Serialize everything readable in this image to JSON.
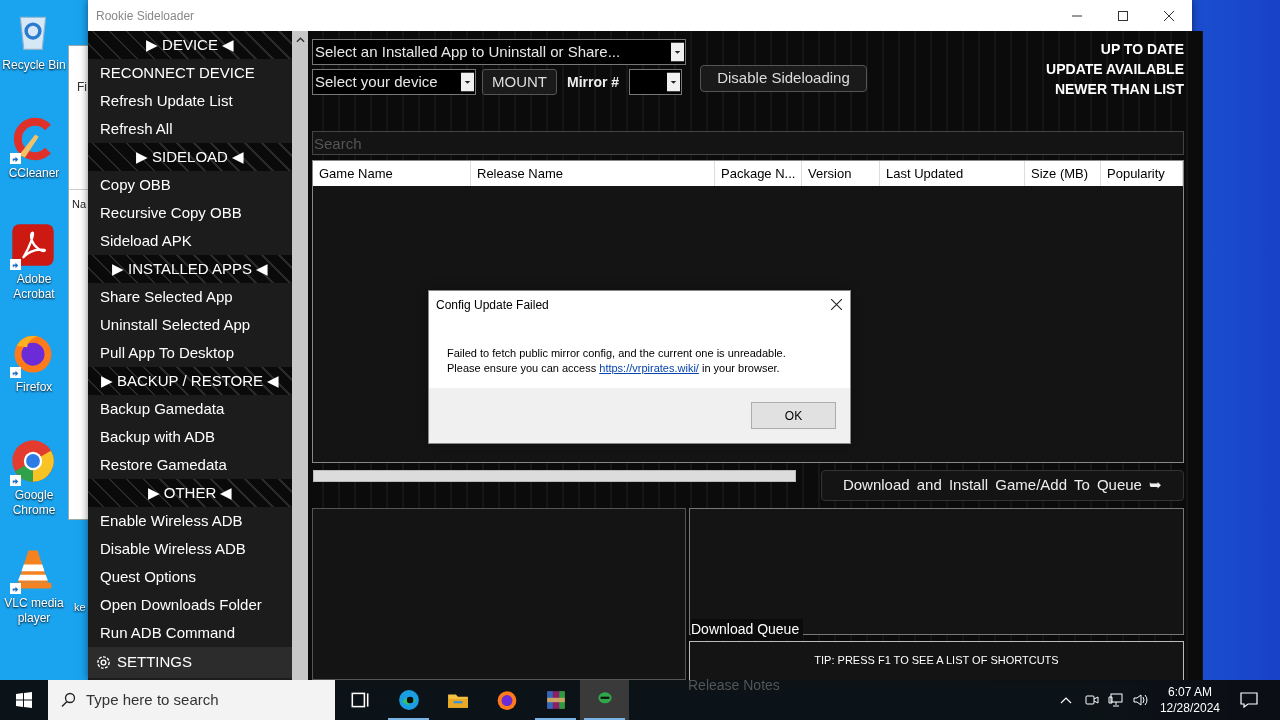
{
  "desktop": {
    "icons": [
      {
        "kind": "recycle",
        "label": "Recycle Bin",
        "shortcut": false
      },
      {
        "kind": "ccleaner",
        "label": "CCleaner",
        "shortcut": true
      },
      {
        "kind": "acrobat",
        "label": "Adobe Acrobat",
        "shortcut": true
      },
      {
        "kind": "firefox",
        "label": "Firefox",
        "shortcut": true
      },
      {
        "kind": "chrome",
        "label": "Google Chrome",
        "shortcut": true
      },
      {
        "kind": "vlc",
        "label": "VLC media player",
        "shortcut": true
      }
    ],
    "partial_label": "ke"
  },
  "background_window": {
    "menu_text": "Fi",
    "column_text": "Na"
  },
  "window": {
    "title": "Rookie Sideloader",
    "sidebar": {
      "sections": [
        {
          "title": "▶ DEVICE ◀",
          "items": [
            "RECONNECT DEVICE",
            "Refresh Update List",
            "Refresh All"
          ]
        },
        {
          "title": "▶ SIDELOAD ◀",
          "items": [
            "Copy OBB",
            "Recursive Copy OBB",
            "Sideload APK"
          ]
        },
        {
          "title": "▶ INSTALLED APPS ◀",
          "items": [
            "Share Selected App",
            "Uninstall Selected App",
            "Pull App To Desktop"
          ]
        },
        {
          "title": "▶ BACKUP / RESTORE ◀",
          "items": [
            "Backup Gamedata",
            "Backup with ADB",
            "Restore Gamedata"
          ]
        },
        {
          "title": "▶ OTHER ◀",
          "items": [
            "Enable Wireless ADB",
            "Disable Wireless ADB",
            "Quest Options",
            "Open Downloads Folder",
            "Run ADB Command"
          ]
        }
      ],
      "settings": "SETTINGS"
    },
    "app_select": "Select an Installed App to Uninstall or Share...",
    "device_select": "Select your device",
    "mount_button": "MOUNT",
    "mirror_label": "Mirror #",
    "disable_button": "Disable Sideloading",
    "status_labels": [
      "UP TO DATE",
      "UPDATE AVAILABLE",
      "NEWER THAN LIST"
    ],
    "search": {
      "placeholder": "Search"
    },
    "table": {
      "columns": [
        "Game Name",
        "Release Name",
        "Package N...",
        "Version",
        "Last Updated",
        "Size (MB)",
        "Popularity"
      ]
    },
    "progress": {
      "level": 0
    },
    "download_button": "Download and Install Game/Add To Queue ➥",
    "queue_label": "Download Queue",
    "tip": "TIP: PRESS F1 TO SEE A LIST OF SHORTCUTS",
    "notes_label": "Release Notes"
  },
  "dialog": {
    "title": "Config Update Failed",
    "line1": "Failed to fetch public mirror config, and the current one is unreadable.",
    "before_link": "Please ensure you can access ",
    "link": "https://vrpirates.wiki/",
    "after_link": " in your browser.",
    "button": "OK"
  },
  "taskbar": {
    "search_placeholder": "Type here to search",
    "apps": [
      {
        "kind": "taskview",
        "running": false,
        "selected": false
      },
      {
        "kind": "edge",
        "running": true,
        "selected": false
      },
      {
        "kind": "explorer",
        "running": false,
        "selected": false
      },
      {
        "kind": "firefox",
        "running": false,
        "selected": false
      },
      {
        "kind": "winrar",
        "running": true,
        "selected": false
      },
      {
        "kind": "rookie",
        "running": true,
        "selected": true
      }
    ],
    "time": "6:07 AM",
    "date": "12/28/2024"
  }
}
